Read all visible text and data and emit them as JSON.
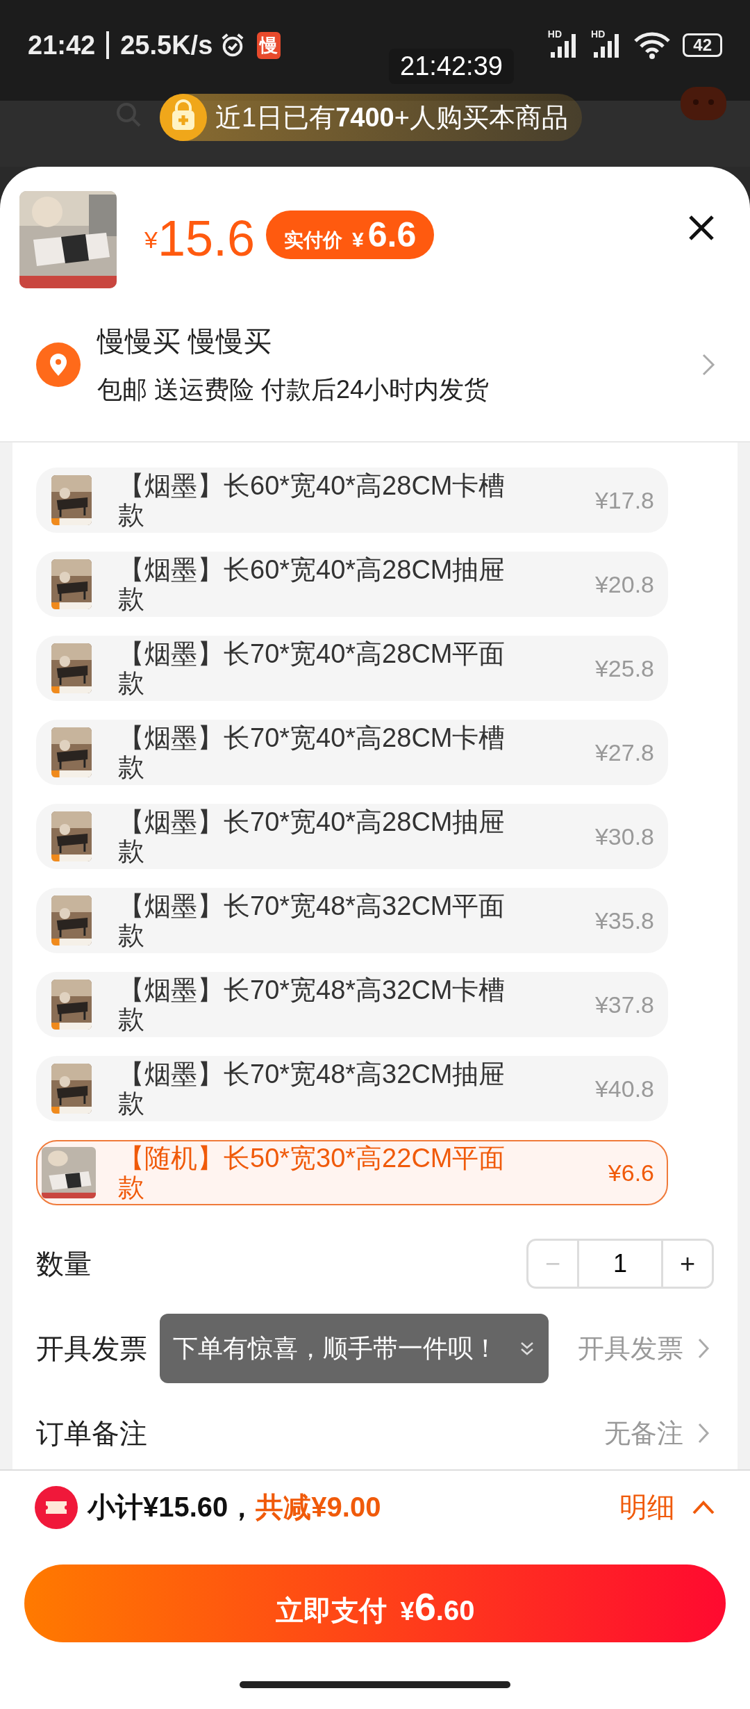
{
  "status_bar": {
    "time": "21:42",
    "speed": "25.5K/s",
    "app_badge": "慢",
    "signals": [
      {
        "label": "HD"
      },
      {
        "label": "HD"
      }
    ],
    "battery": "42"
  },
  "overlay_time": "21:42:39",
  "banner": {
    "text": "近1日已有**7400**+人购买本商品"
  },
  "product": {
    "price_symbol": "¥",
    "price": "15.6",
    "badge_label": "实付价",
    "badge_symbol": "¥",
    "badge_price": "6.6"
  },
  "address": {
    "name": "慢慢买 慢慢买",
    "note": "包邮 送运费险 付款后24小时内发货"
  },
  "options": [
    {
      "label": "【烟墨】长60*宽40*高28CM卡槽款",
      "price": "¥17.8",
      "selected": false
    },
    {
      "label": "【烟墨】长60*宽40*高28CM抽屉款",
      "price": "¥20.8",
      "selected": false
    },
    {
      "label": "【烟墨】长70*宽40*高28CM平面款",
      "price": "¥25.8",
      "selected": false
    },
    {
      "label": "【烟墨】长70*宽40*高28CM卡槽款",
      "price": "¥27.8",
      "selected": false
    },
    {
      "label": "【烟墨】长70*宽40*高28CM抽屉款",
      "price": "¥30.8",
      "selected": false
    },
    {
      "label": "【烟墨】长70*宽48*高32CM平面款",
      "price": "¥35.8",
      "selected": false
    },
    {
      "label": "【烟墨】长70*宽48*高32CM卡槽款",
      "price": "¥37.8",
      "selected": false
    },
    {
      "label": "【烟墨】长70*宽48*高32CM抽屉款",
      "price": "¥40.8",
      "selected": false
    },
    {
      "label": "【随机】长50*宽30*高22CM平面款",
      "price": "¥6.6",
      "selected": true
    }
  ],
  "quantity": {
    "label": "数量",
    "minus": "−",
    "value": "1",
    "plus": "+",
    "minus_disabled": true
  },
  "rows": [
    {
      "label": "开具发票",
      "value": "开具发票"
    },
    {
      "label": "订单备注",
      "value": "无备注"
    }
  ],
  "toast": "下单有惊喜，顺手带一件呗！",
  "summary": {
    "subtotal": "小计¥15.60，",
    "discount": "共减¥9.00",
    "detail": "明细"
  },
  "pay_button": {
    "label": "立即支付",
    "symbol": "¥",
    "whole": "6",
    "fraction": ".60"
  }
}
